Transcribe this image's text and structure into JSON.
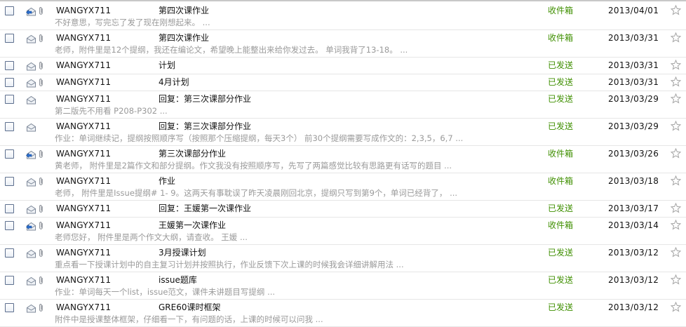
{
  "mails": [
    {
      "sender": "WANGYX711",
      "subject": "第四次课作业",
      "preview": "不好意思，写完忘了发了现在刚想起来。  ...",
      "folder": "收件箱",
      "date": "2013/04/01",
      "icon": "reply-envelope-icon",
      "attachment": true
    },
    {
      "sender": "WANGYX711",
      "subject": "第四次课作业",
      "preview": "老师，附件里是12个提纲，我还在编论文，希望晚上能整出来给你发过去。 单词我背了13-18。   ...",
      "folder": "收件箱",
      "date": "2013/03/31",
      "icon": "read-envelope-icon",
      "attachment": true
    },
    {
      "sender": "WANGYX711",
      "subject": "计划",
      "preview": "",
      "folder": "已发送",
      "date": "2013/03/31",
      "icon": "read-envelope-icon",
      "attachment": true
    },
    {
      "sender": "WANGYX711",
      "subject": "4月计划",
      "preview": "",
      "folder": "已发送",
      "date": "2013/03/31",
      "icon": "read-envelope-icon",
      "attachment": true
    },
    {
      "sender": "WANGYX711",
      "subject": "回复：第三次课部分作业",
      "preview": "第二版先不用看 P208-P302 ...",
      "folder": "已发送",
      "date": "2013/03/29",
      "icon": "read-envelope-icon",
      "attachment": false
    },
    {
      "sender": "WANGYX711",
      "subject": "回复：第三次课部分作业",
      "preview": "作业：单词继续记，提纲按照顺序写（按照那个压缩提纲，每天3个） 前30个提纲需要写成作文的：2,3,5，6,7 ...",
      "folder": "已发送",
      "date": "2013/03/29",
      "icon": "read-envelope-icon",
      "attachment": false
    },
    {
      "sender": "WANGYX711",
      "subject": "第三次课部分作业",
      "preview": "黄老师，  附件里是2篇作文和部分提纲。作文我没有按照顺序写，先写了两篇感觉比较有思路更有话写的题目 ...",
      "folder": "收件箱",
      "date": "2013/03/26",
      "icon": "reply-envelope-icon",
      "attachment": true
    },
    {
      "sender": "WANGYX711",
      "subject": "作业",
      "preview": "老师，   附件里是Issue提纲# 1- 9。这两天有事耽误了昨天凌晨刚回北京，提纲只写到第9个，单词已经背了， ...",
      "folder": "收件箱",
      "date": "2013/03/18",
      "icon": "read-envelope-icon",
      "attachment": true
    },
    {
      "sender": "WANGYX711",
      "subject": "回复：王媛第一次课作业",
      "preview": "",
      "folder": "已发送",
      "date": "2013/03/17",
      "icon": "read-envelope-icon",
      "attachment": true
    },
    {
      "sender": "WANGYX711",
      "subject": "王媛第一次课作业",
      "preview": "老师您好，   附件里是两个作文大纲，请查收。  王媛  ...",
      "folder": "收件箱",
      "date": "2013/03/14",
      "icon": "reply-envelope-icon",
      "attachment": true
    },
    {
      "sender": "WANGYX711",
      "subject": "3月授课计划",
      "preview": "重点看一下授课计划中的自主复习计划并按照执行，作业反馈下次上课的时候我会详细讲解用法 ...",
      "folder": "已发送",
      "date": "2013/03/12",
      "icon": "read-envelope-icon",
      "attachment": true
    },
    {
      "sender": "WANGYX711",
      "subject": "issue题库",
      "preview": "作业：单词每天一个list，issue范文，课件未讲题目写提纲  ...",
      "folder": "已发送",
      "date": "2013/03/12",
      "icon": "read-envelope-icon",
      "attachment": true
    },
    {
      "sender": "WANGYX711",
      "subject": "GRE60课时框架",
      "preview": "附件中是授课整体框架，仔细看一下，有问题的话，上课的时候可以问我  ...",
      "folder": "已发送",
      "date": "2013/03/12",
      "icon": "read-envelope-icon",
      "attachment": true
    }
  ]
}
